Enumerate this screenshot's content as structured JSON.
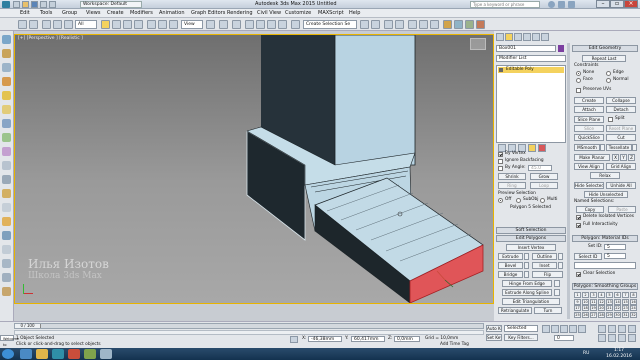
{
  "window": {
    "title": "Autodesk 3ds Max 2015   Untitled",
    "workspace": "Workspace: Default",
    "search_placeholder": "Type a keyword or phrase"
  },
  "menu": [
    "Edit",
    "Tools",
    "Group",
    "Views",
    "Create",
    "Modifiers",
    "Animation",
    "Graph Editors",
    "Rendering",
    "Civil View",
    "Customize",
    "MAXScript",
    "Help"
  ],
  "toolbar": {
    "selection_filter": "All",
    "view_dropdown": "View",
    "create_selection_set": "Create Selection Se"
  },
  "viewport": {
    "label": "[+] [Perspective ] [Realistic ]"
  },
  "watermark": {
    "line1": "Илья Изотов",
    "line2": "Школа 3ds Max"
  },
  "command_panel": {
    "object_name": "Box001",
    "modifier_list": "Modifier List",
    "stack_item": "Editable Poly",
    "selection": {
      "by_vertex": "By Vertex",
      "ignore_backfacing": "Ignore Backfacing",
      "by_angle": "By Angle:",
      "angle_value": "45.0",
      "shrink": "Shrink",
      "grow": "Grow",
      "ring": "Ring",
      "loop": "Loop",
      "preview_selection": "Preview Selection",
      "off": "Off",
      "subobj": "SubObj",
      "multi": "Multi",
      "status": "Polygon 5 Selected"
    },
    "soft_selection": "Soft Selection",
    "edit_polygons": {
      "title": "Edit Polygons",
      "insert_vertex": "Insert Vertex",
      "extrude": "Extrude",
      "outline": "Outline",
      "bevel": "Bevel",
      "inset": "Inset",
      "bridge": "Bridge",
      "flip": "Flip",
      "hinge": "Hinge From Edge",
      "extrude_spline": "Extrude Along Spline",
      "edit_triangulation": "Edit Triangulation",
      "retriangulate": "Retriangulate",
      "turn": "Turn"
    }
  },
  "edit_geometry": {
    "title": "Edit Geometry",
    "repeat_last": "Repeat Last",
    "constraints": "Constraints",
    "none": "None",
    "edge": "Edge",
    "face": "Face",
    "normal": "Normal",
    "preserve_uvs": "Preserve UVs",
    "create": "Create",
    "collapse": "Collapse",
    "attach": "Attach",
    "detach": "Detach",
    "slice_plane": "Slice Plane",
    "split": "Split",
    "slice": "Slice",
    "reset_plane": "Reset Plane",
    "quickslice": "QuickSlice",
    "cut": "Cut",
    "msmooth": "MSmooth",
    "tessellate": "Tessellate",
    "make_planar": "Make Planar",
    "x": "X",
    "y": "Y",
    "z": "Z",
    "view_align": "View Align",
    "grid_align": "Grid Align",
    "relax": "Relax",
    "hide_selected": "Hide Selected",
    "unhide_all": "Unhide All",
    "hide_unselected": "Hide Unselected",
    "named_selections": "Named Selections:",
    "copy": "Copy",
    "paste": "Paste",
    "delete_isolated": "Delete Isolated Vertices",
    "full_interactivity": "Full Interactivity"
  },
  "material_ids": {
    "title": "Polygon: Material IDs",
    "set_id": "Set ID:",
    "set_id_value": "5",
    "select_id": "Select ID",
    "select_id_value": "5",
    "clear_selection": "Clear Selection"
  },
  "smoothing_groups": {
    "title": "Polygon: Smoothing Groups",
    "groups": [
      "1",
      "2",
      "3",
      "4",
      "5",
      "6",
      "7",
      "8",
      "9",
      "10",
      "11",
      "12",
      "13",
      "14",
      "15",
      "16",
      "17",
      "18",
      "19",
      "20",
      "21",
      "22",
      "23",
      "24",
      "25",
      "26",
      "27",
      "28",
      "29",
      "30",
      "31",
      "32"
    ]
  },
  "status": {
    "time_slider": "0 / 100",
    "objects_selected": "1 Object Selected",
    "prompt": "Click or click-and-drag to select objects",
    "welcome": "Welcome to MA",
    "x_value": "-46,38mm",
    "y_value": "60,417mm",
    "z_value": "0,0mm",
    "grid": "Grid = 10,0mm",
    "auto_key": "Auto Key",
    "selected": "Selected",
    "set_key": "Set Key",
    "key_filters": "Key Filters...",
    "add_time_tag": "Add Time Tag",
    "frame": "0"
  },
  "taskbar": {
    "lang": "RU",
    "time": "1:17",
    "date": "16.02.2016"
  }
}
